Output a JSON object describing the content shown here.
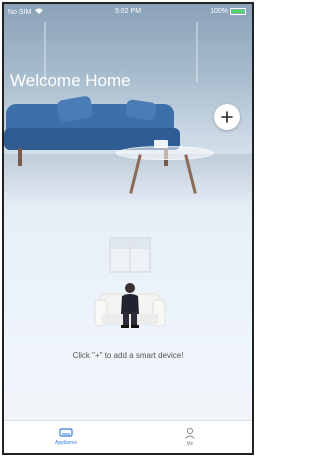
{
  "status_bar": {
    "carrier": "No SIM",
    "time": "5:02 PM",
    "battery": "100%"
  },
  "home": {
    "title": "Welcome Home",
    "add_icon": "plus-icon",
    "empty_hint": "Click \"+\" to add a smart device!"
  },
  "tabbar": {
    "tabs": [
      {
        "label": "Appliance",
        "icon": "appliance-icon",
        "active": true
      },
      {
        "label": "Me",
        "icon": "person-icon",
        "active": false
      }
    ]
  },
  "colors": {
    "accent": "#3b7ddd",
    "sofa": "#3d6fa8",
    "battery": "#4cd964"
  }
}
